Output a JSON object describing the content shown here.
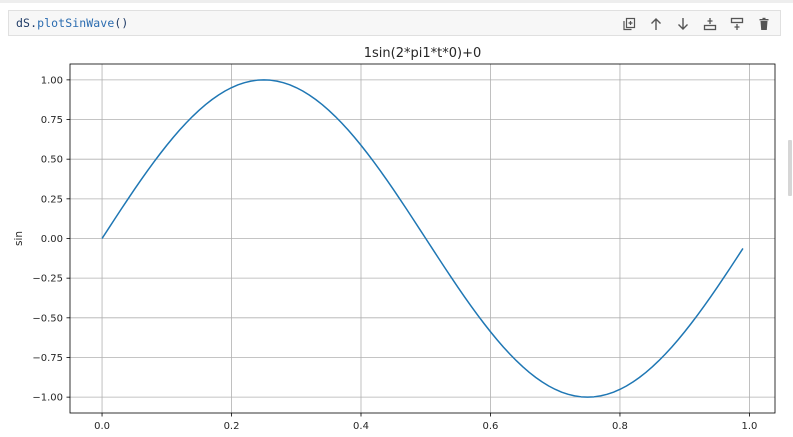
{
  "cell": {
    "code_object": "dS",
    "code_dot": ".",
    "code_method": "plotSinWave",
    "code_parens": "()"
  },
  "toolbar": {
    "buttons": [
      {
        "name": "duplicate-cell-icon"
      },
      {
        "name": "move-up-icon"
      },
      {
        "name": "move-down-icon"
      },
      {
        "name": "insert-cell-above-icon"
      },
      {
        "name": "insert-cell-below-icon"
      },
      {
        "name": "delete-cell-icon"
      }
    ]
  },
  "chart_data": {
    "type": "line",
    "title": "1sin(2*pi1*t*0)+0",
    "xlabel": "",
    "ylabel": "sin",
    "xlim": [
      -0.0495,
      1.0395
    ],
    "ylim": [
      -1.1,
      1.1
    ],
    "xticks": [
      0.0,
      0.2,
      0.4,
      0.6,
      0.8,
      1.0
    ],
    "xtick_labels": [
      "0.0",
      "0.2",
      "0.4",
      "0.6",
      "0.8",
      "1.0"
    ],
    "yticks": [
      1.0,
      0.75,
      0.5,
      0.25,
      0.0,
      -0.25,
      -0.5,
      -0.75,
      -1.0
    ],
    "ytick_labels": [
      "1.00",
      "0.75",
      "0.50",
      "0.25",
      "0.00",
      "−0.25",
      "−0.50",
      "−0.75",
      "−1.00"
    ],
    "grid": true,
    "series": [
      {
        "color": "#1f77b4",
        "function": "sin(2*pi*t)",
        "x_start": 0.0,
        "x_end": 0.99,
        "x_step": 0.01
      }
    ]
  }
}
